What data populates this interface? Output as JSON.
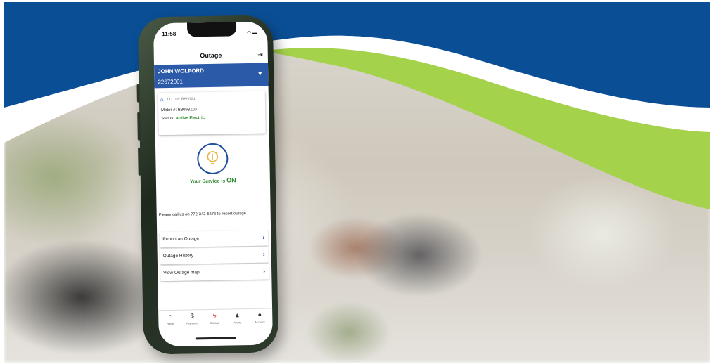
{
  "colors": {
    "brand_blue": "#0a4f96",
    "brand_green": "#a4d24a",
    "header_blue": "#2a5aa8",
    "status_green": "#2e8b2e",
    "active_tab_red": "#d9342b"
  },
  "status_bar": {
    "time": "11:58",
    "icons": "wifi-icon battery-icon"
  },
  "screen": {
    "title": "Outage",
    "logout_icon": "logout-icon"
  },
  "account": {
    "name": "JOHN WOLFORD",
    "number": "22672001",
    "expand_icon": "triangle-down-icon"
  },
  "rental": {
    "icon": "home-icon",
    "name": "LITTLE RENTAL",
    "meter_label": "Meter #:",
    "meter_value": "B8093110",
    "status_label": "Status:",
    "status_value": "Active Electric"
  },
  "service": {
    "icon": "lightbulb-icon",
    "text": "Your Service is",
    "state": "ON"
  },
  "call_message": "Please call us on 772-343-5676 to report outage.",
  "menu": [
    {
      "label": "Report an Outage",
      "icon": "chevron-right-icon"
    },
    {
      "label": "Outage History",
      "icon": "chevron-right-icon"
    },
    {
      "label": "View Outage map",
      "icon": "chevron-right-icon"
    }
  ],
  "tabs": [
    {
      "label": "Home",
      "icon": "home-icon",
      "glyph": "⌂",
      "active": false
    },
    {
      "label": "Payments",
      "icon": "dollar-icon",
      "glyph": "$",
      "active": false
    },
    {
      "label": "Outage",
      "icon": "bolt-icon",
      "glyph": "ϟ",
      "active": true
    },
    {
      "label": "Alerts",
      "icon": "bell-icon",
      "glyph": "▲",
      "active": false
    },
    {
      "label": "Account",
      "icon": "person-icon",
      "glyph": "●",
      "active": false
    }
  ]
}
